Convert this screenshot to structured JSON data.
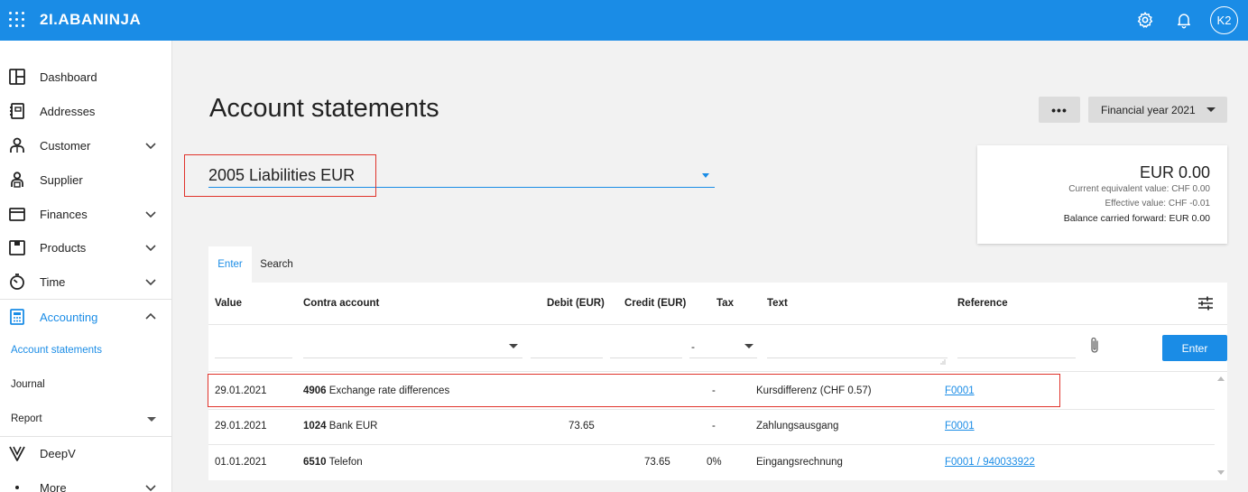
{
  "app": {
    "brand": "2I.ABANINJA",
    "avatar": "K2",
    "icons": [
      "apps-grid-icon",
      "gear-icon",
      "bell-icon"
    ]
  },
  "sidebar": {
    "items": [
      {
        "label": "Dashboard",
        "icon": "dashboard-icon"
      },
      {
        "label": "Addresses",
        "icon": "address-book-icon"
      },
      {
        "label": "Customer",
        "icon": "customer-icon",
        "expandable": true
      },
      {
        "label": "Supplier",
        "icon": "supplier-icon"
      },
      {
        "label": "Finances",
        "icon": "wallet-icon",
        "expandable": true
      },
      {
        "label": "Products",
        "icon": "box-icon",
        "expandable": true
      },
      {
        "label": "Time",
        "icon": "stopwatch-icon",
        "expandable": true
      },
      {
        "label": "Accounting",
        "icon": "calculator-icon",
        "expanded": true,
        "active": true
      }
    ],
    "sub_items": [
      {
        "label": "Account statements",
        "active": true
      },
      {
        "label": "Journal"
      },
      {
        "label": "Report",
        "dropdown": true
      }
    ],
    "bottom_items": [
      {
        "label": "DeepV",
        "icon": "deepv-icon"
      },
      {
        "label": "More",
        "icon": "more-icon",
        "expandable": true
      }
    ]
  },
  "page": {
    "title": "Account statements",
    "more_label": "•••",
    "financial_year": "Financial year 2021",
    "account": "2005 Liabilities EUR"
  },
  "balance": {
    "amount": "EUR 0.00",
    "current_equivalent": "Current equivalent value: CHF 0.00",
    "effective": "Effective value: CHF -0.01",
    "carried_forward": "Balance carried forward: EUR 0.00"
  },
  "tabs": [
    {
      "label": "Enter",
      "active": true
    },
    {
      "label": "Search"
    }
  ],
  "table": {
    "columns": [
      "Value",
      "Contra account",
      "Debit (EUR)",
      "Credit (EUR)",
      "Tax",
      "Text",
      "Reference"
    ],
    "entry": {
      "tax_value": "-",
      "enter_label": "Enter"
    },
    "rows": [
      {
        "value": "29.01.2021",
        "account_no": "4906",
        "account_name": "Exchange rate differences",
        "debit": "",
        "credit": "",
        "tax": "-",
        "text": "Kursdifferenz (CHF 0.57)",
        "reference": "F0001"
      },
      {
        "value": "29.01.2021",
        "account_no": "1024",
        "account_name": "Bank EUR",
        "debit": "73.65",
        "credit": "",
        "tax": "-",
        "text": "Zahlungsausgang",
        "reference": "F0001"
      },
      {
        "value": "01.01.2021",
        "account_no": "6510",
        "account_name": "Telefon",
        "debit": "",
        "credit": "73.65",
        "tax": "0%",
        "text": "Eingangsrechnung",
        "reference": "F0001 / 940033922"
      }
    ]
  },
  "colors": {
    "primary": "#1a8ce6",
    "highlight": "#e0332b",
    "background": "#f2f2f2"
  }
}
